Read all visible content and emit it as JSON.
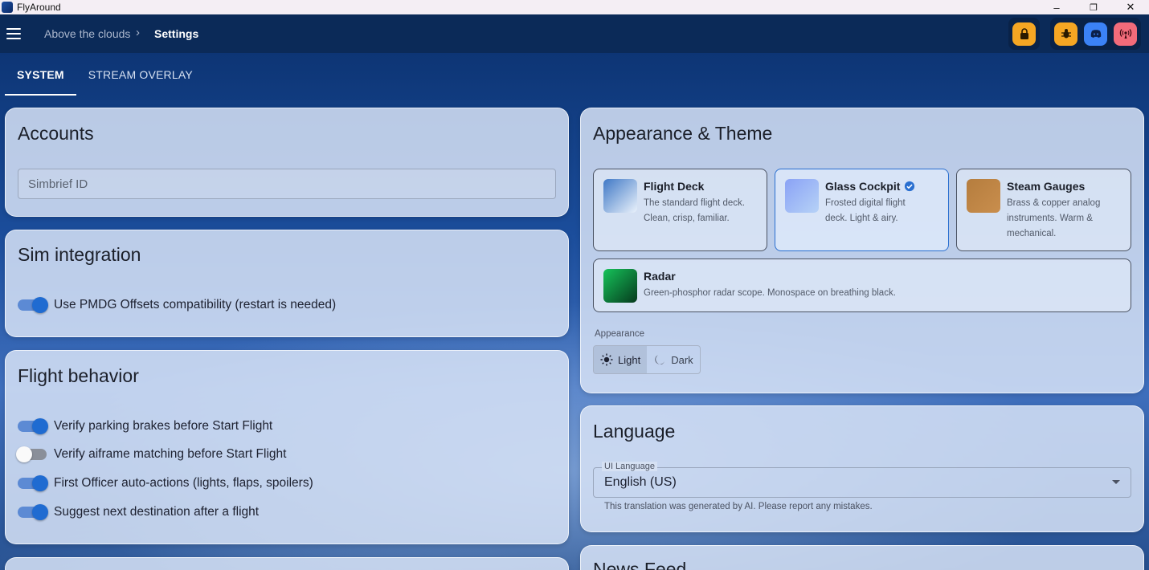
{
  "window": {
    "title": "FlyAround",
    "controls": [
      "–",
      "❐",
      "✕"
    ]
  },
  "header": {
    "breadcrumb_parent": "Above the clouds",
    "breadcrumb_separator": "›",
    "breadcrumb_current": "Settings",
    "buttons": [
      {
        "icon": "lock-icon",
        "color": "#f5a623"
      },
      {
        "icon": "bug-icon",
        "color": "#f5a623"
      },
      {
        "icon": "discord-icon",
        "color": "#3b82f6"
      },
      {
        "icon": "broadcast-icon",
        "color": "#f26b7a"
      }
    ]
  },
  "tabs": [
    {
      "label": "SYSTEM",
      "active": true
    },
    {
      "label": "STREAM OVERLAY",
      "active": false
    }
  ],
  "accounts": {
    "title": "Accounts",
    "simbrief_placeholder": "Simbrief ID"
  },
  "sim_integration": {
    "title": "Sim integration",
    "toggles": [
      {
        "label": "Use PMDG Offsets compatibility (restart is needed)",
        "on": true
      }
    ]
  },
  "flight_behavior": {
    "title": "Flight behavior",
    "toggles": [
      {
        "label": "Verify parking brakes before Start Flight",
        "on": true
      },
      {
        "label": "Verify aiframe matching before Start Flight",
        "on": false
      },
      {
        "label": "First Officer auto-actions (lights, flaps, spoilers)",
        "on": true
      },
      {
        "label": "Suggest next destination after a flight",
        "on": true
      }
    ]
  },
  "appearance": {
    "title": "Appearance & Theme",
    "themes": [
      {
        "name": "Flight Deck",
        "desc_lines": [
          "The standard flight deck.",
          "Clean, crisp, familiar."
        ],
        "selected": false
      },
      {
        "name": "Glass Cockpit",
        "desc_lines": [
          "Frosted digital flight",
          "deck. Light & airy."
        ],
        "selected": true
      },
      {
        "name": "Steam Gauges",
        "desc_lines": [
          "Brass & copper analog",
          "instruments. Warm &",
          "mechanical."
        ],
        "selected": false
      },
      {
        "name": "Radar",
        "desc_lines": [
          "Green-phosphor radar scope. Monospace on breathing black."
        ],
        "selected": false
      }
    ],
    "mode_label": "Appearance",
    "mode_options": [
      {
        "label": "Light",
        "icon": "sun-icon",
        "active": true
      },
      {
        "label": "Dark",
        "icon": "moon-icon",
        "active": false
      }
    ]
  },
  "language": {
    "title": "Language",
    "field_label": "UI Language",
    "value": "English (US)",
    "note": "This translation was generated by AI. Please report any mistakes."
  },
  "news_feed": {
    "title": "News Feed"
  }
}
